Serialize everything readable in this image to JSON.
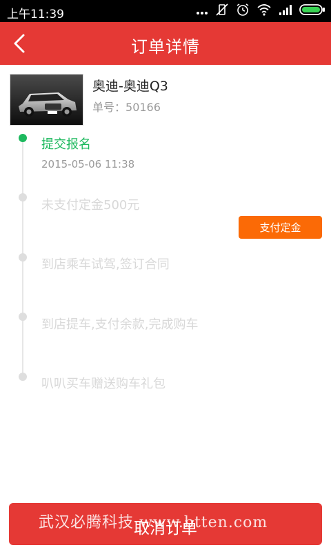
{
  "status_bar": {
    "time": "上午11:39"
  },
  "header": {
    "title": "订单详情",
    "back_icon": "chevron-left-icon"
  },
  "order": {
    "car_name": "奥迪-奥迪Q3",
    "order_number_label": "单号：",
    "order_number": "50166"
  },
  "timeline": {
    "steps": [
      {
        "label": "提交报名",
        "time": "2015-05-06 11:38",
        "done": true
      },
      {
        "label": "未支付定金500元",
        "done": false
      },
      {
        "label": "到店乘车试驾,签订合同",
        "done": false
      },
      {
        "label": "到店提车,支付余款,完成购车",
        "done": false
      },
      {
        "label": "叭叭买车赠送购车礼包",
        "done": false
      }
    ],
    "pay_button_label": "支付定金"
  },
  "footer": {
    "cancel_button_label": "取消订单",
    "watermark": "武汉必腾科技  www.btten.com"
  },
  "colors": {
    "brand_red": "#e53935",
    "active_green": "#1db95e",
    "pay_orange": "#fb6a06"
  }
}
